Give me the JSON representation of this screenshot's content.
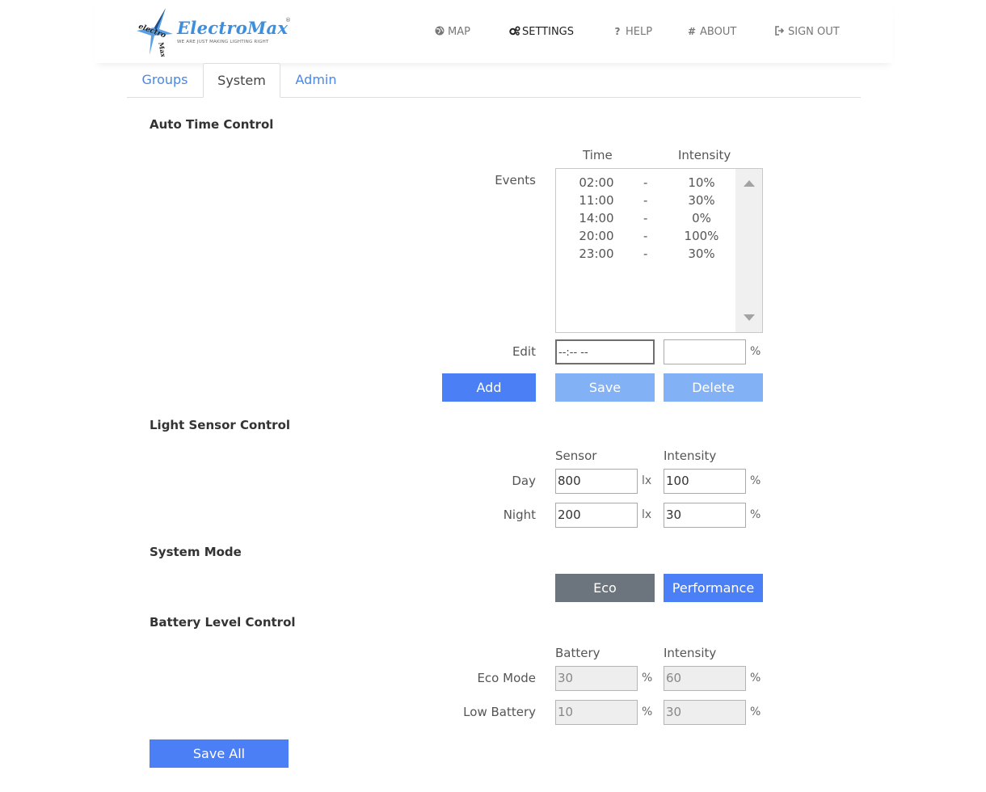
{
  "brand": {
    "name": "ElectroMax",
    "registered": "®",
    "tagline": "WE ARE JUST MAKING LIGHTING RIGHT",
    "mark_text": "electro Max"
  },
  "nav": {
    "map": "MAP",
    "settings": "SETTINGS",
    "help": "HELP",
    "about": "ABOUT",
    "sign_out": "SIGN OUT",
    "help_icon": "?",
    "about_icon": "#"
  },
  "tabs": [
    "Groups",
    "System",
    "Admin"
  ],
  "auto_time": {
    "title": "Auto Time Control",
    "col_time": "Time",
    "col_intensity": "Intensity",
    "events_label": "Events",
    "events": [
      {
        "time": "02:00",
        "sep": "-",
        "intensity": "10%"
      },
      {
        "time": "11:00",
        "sep": "-",
        "intensity": "30%"
      },
      {
        "time": "14:00",
        "sep": "-",
        "intensity": "0%"
      },
      {
        "time": "20:00",
        "sep": "-",
        "intensity": "100%"
      },
      {
        "time": "23:00",
        "sep": "-",
        "intensity": "30%"
      }
    ],
    "edit_label": "Edit",
    "edit_time_value": "--:-- --",
    "edit_intensity_value": "",
    "percent": "%",
    "add": "Add",
    "save": "Save",
    "delete": "Delete"
  },
  "light_sensor": {
    "title": "Light Sensor Control",
    "col_sensor": "Sensor",
    "col_intensity": "Intensity",
    "day_label": "Day",
    "night_label": "Night",
    "day_sensor": "800",
    "day_intensity": "100",
    "night_sensor": "200",
    "night_intensity": "30",
    "lux_unit": "lx",
    "percent": "%"
  },
  "system_mode": {
    "title": "System Mode",
    "eco": "Eco",
    "performance": "Performance"
  },
  "battery": {
    "title": "Battery Level Control",
    "col_battery": "Battery",
    "col_intensity": "Intensity",
    "eco_label": "Eco Mode",
    "low_label": "Low Battery",
    "eco_battery": "30",
    "eco_intensity": "60",
    "low_battery": "10",
    "low_intensity": "30",
    "percent": "%"
  },
  "save_all": "Save All",
  "colors": {
    "primary": "#4a7ff5",
    "primary_light": "#82b1f5",
    "secondary": "#6c757d",
    "link": "#4a86e8",
    "logo": "#3e8ede"
  }
}
